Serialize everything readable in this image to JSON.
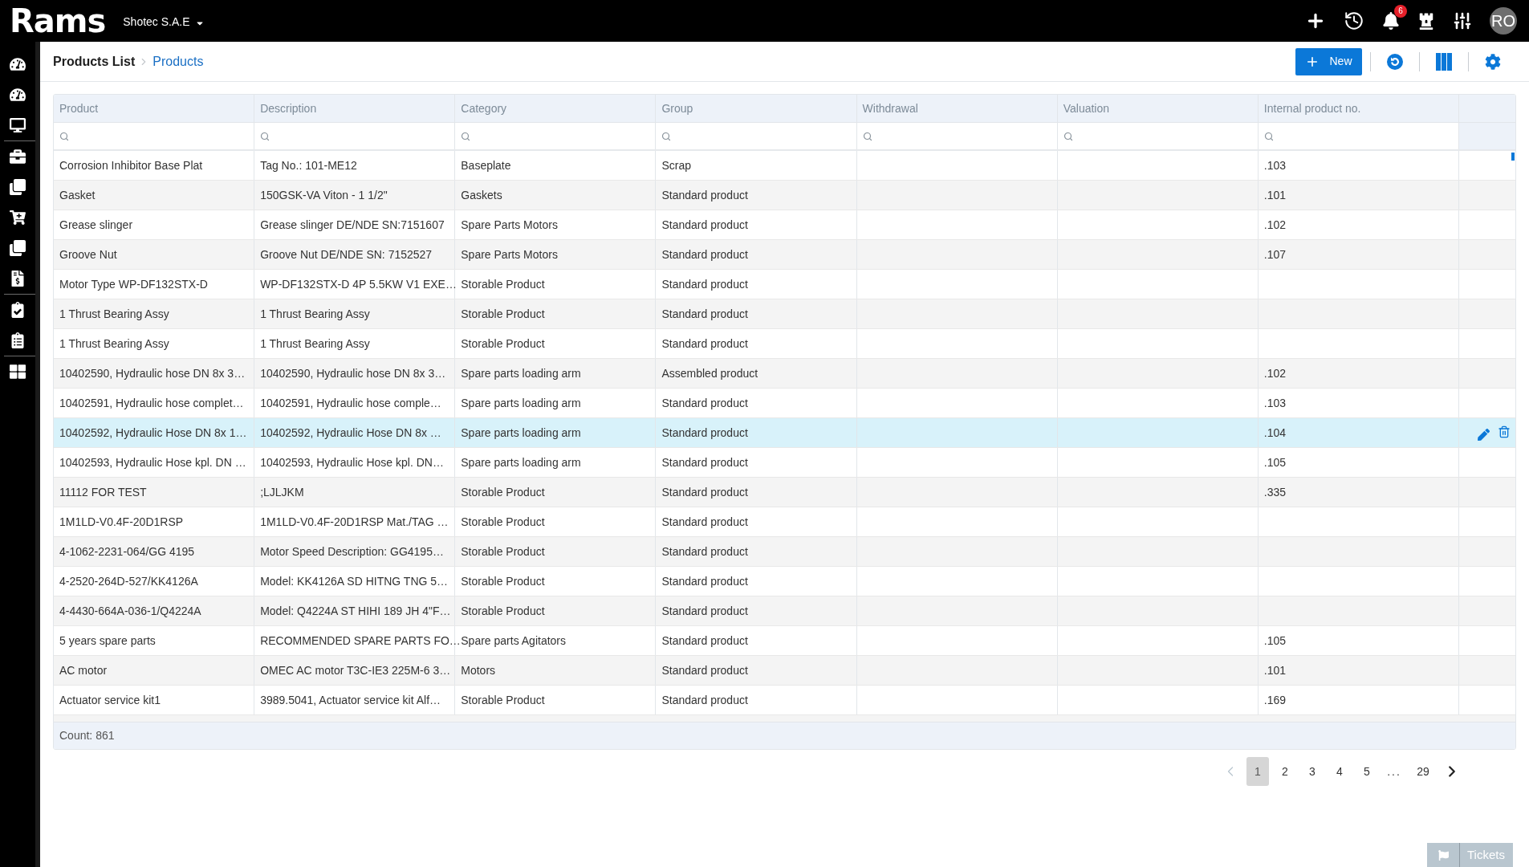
{
  "header": {
    "logo": "Rams",
    "company": "Shotec S.A.E",
    "notifications_badge": "6",
    "avatar_initials": "RO"
  },
  "breadcrumb": [
    {
      "label": "Products List",
      "selected": false
    },
    {
      "label": "Products",
      "selected": true
    }
  ],
  "toolbar": {
    "new_button": "New"
  },
  "table": {
    "columns": [
      "Product",
      "Description",
      "Category",
      "Group",
      "Withdrawal",
      "Valuation",
      "Internal product no."
    ],
    "rows": [
      {
        "product": "Corrosion Inhibitor Base Plat",
        "description": "Tag No.: 101-ME12",
        "category": "Baseplate",
        "group": "Scrap",
        "internal_product_no": ".103",
        "selected": false
      },
      {
        "product": "Gasket",
        "description": "150GSK-VA Viton - 1 1/2\"",
        "category": "Gaskets",
        "group": "Standard product",
        "internal_product_no": ".101",
        "selected": false
      },
      {
        "product": "Grease slinger",
        "description": "Grease slinger DE/NDE SN:7151607",
        "category": "Spare Parts Motors",
        "group": "Standard product",
        "internal_product_no": ".102",
        "selected": false
      },
      {
        "product": "Groove Nut",
        "description": "Groove Nut DE/NDE SN: 7152527",
        "category": "Spare Parts Motors",
        "group": "Standard product",
        "internal_product_no": ".107",
        "selected": false
      },
      {
        "product": "Motor Type WP-DF132STX-D",
        "description": "WP-DF132STX-D 4P 5.5KW V1 EXE…",
        "category": "Storable Product",
        "group": "Standard product",
        "selected": false
      },
      {
        "product": "1 Thrust Bearing Assy",
        "description": "1 Thrust Bearing Assy",
        "category": "Storable Product",
        "group": "Standard product",
        "selected": false
      },
      {
        "product": "1 Thrust Bearing Assy",
        "description": "1 Thrust Bearing Assy",
        "category": "Storable Product",
        "group": "Standard product",
        "selected": false
      },
      {
        "product": "10402590, Hydraulic hose DN 8x 3…",
        "description": "10402590, Hydraulic hose DN 8x 3…",
        "category": "Spare parts loading arm",
        "group": "Assembled product",
        "internal_product_no": ".102",
        "selected": false
      },
      {
        "product": "10402591, Hydraulic hose complet…",
        "description": "10402591, Hydraulic hose comple…",
        "category": "Spare parts loading arm",
        "group": "Standard product",
        "internal_product_no": ".103",
        "selected": false
      },
      {
        "product": "10402592, Hydraulic Hose DN 8x 1…",
        "description": "10402592, Hydraulic Hose DN 8x …",
        "category": "Spare parts loading arm",
        "group": "Standard product",
        "internal_product_no": ".104",
        "selected": true
      },
      {
        "product": "10402593, Hydraulic Hose kpl. DN …",
        "description": "10402593, Hydraulic Hose kpl. DN…",
        "category": "Spare parts loading arm",
        "group": "Standard product",
        "internal_product_no": ".105",
        "selected": false
      },
      {
        "product": "11112 FOR TEST",
        "description": ";LJLJKM",
        "category": "Storable Product",
        "group": "Standard product",
        "internal_product_no": ".335",
        "selected": false
      },
      {
        "product": "1M1LD-V0.4F-20D1RSP",
        "description": "1M1LD-V0.4F-20D1RSP Mat./TAG …",
        "category": "Storable Product",
        "group": "Standard product",
        "selected": false
      },
      {
        "product": "4-1062-2231-064/GG 4195",
        "description": "Motor Speed Description: GG4195…",
        "category": "Storable Product",
        "group": "Standard product",
        "selected": false
      },
      {
        "product": "4-2520-264D-527/KK4126A",
        "description": "Model: KK4126A SD HITNG TNG 5…",
        "category": "Storable Product",
        "group": "Standard product",
        "selected": false
      },
      {
        "product": "4-4430-664A-036-1/Q4224A",
        "description": "Model: Q4224A ST HIHI 189 JH 4\"F…",
        "category": "Storable Product",
        "group": "Standard product",
        "selected": false
      },
      {
        "product": "5 years spare parts",
        "description": "RECOMMENDED SPARE PARTS FO…",
        "category": "Spare parts Agitators",
        "group": "Standard product",
        "internal_product_no": ".105",
        "selected": false
      },
      {
        "product": "AC motor",
        "description": "OMEC AC motor T3C-IE3 225M-6 3…",
        "category": "Motors",
        "group": "Standard product",
        "internal_product_no": ".101",
        "selected": false
      },
      {
        "product": "Actuator service kit1",
        "description": "3989.5041, Actuator service kit Alf…",
        "category": "Storable Product",
        "group": "Standard product",
        "internal_product_no": ".169",
        "selected": false
      }
    ],
    "count": "Count: 861"
  },
  "pagination": {
    "prev": {
      "disabled": true
    },
    "next": {
      "disabled": false
    },
    "pages": [
      {
        "label": "1",
        "selected": true
      },
      {
        "label": "2",
        "selected": false
      },
      {
        "label": "3",
        "selected": false
      },
      {
        "label": "4",
        "selected": false
      },
      {
        "label": "5",
        "selected": false
      }
    ],
    "ellipsis": "...",
    "last_page": {
      "label": "29",
      "selected": false
    }
  },
  "tickets_button": "Tickets"
}
